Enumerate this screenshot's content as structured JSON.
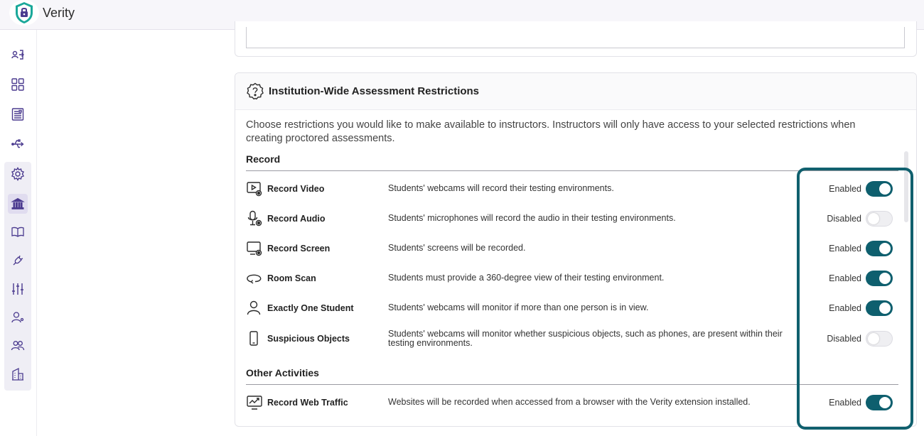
{
  "app": {
    "title": "Verity"
  },
  "card": {
    "title": "Institution-Wide Assessment Restrictions",
    "description": "Choose restrictions you would like to make available to instructors. Instructors will only have access to your selected restrictions when creating proctored assessments."
  },
  "sections": {
    "record": {
      "title": "Record",
      "rows": [
        {
          "name": "Record Video",
          "description": "Students' webcams will record their testing environments.",
          "status": "Enabled",
          "enabled": true,
          "icon": "video-icon"
        },
        {
          "name": "Record Audio",
          "description": "Students' microphones will record the audio in their testing environments.",
          "status": "Disabled",
          "enabled": false,
          "icon": "microphone-icon"
        },
        {
          "name": "Record Screen",
          "description": "Students' screens will be recorded.",
          "status": "Enabled",
          "enabled": true,
          "icon": "screen-icon"
        },
        {
          "name": "Room Scan",
          "description": "Students must provide a 360-degree view of their testing environment.",
          "status": "Enabled",
          "enabled": true,
          "icon": "room-scan-icon"
        },
        {
          "name": "Exactly One Student",
          "description": "Students' webcams will monitor if more than one person is in view.",
          "status": "Enabled",
          "enabled": true,
          "icon": "person-icon"
        },
        {
          "name": "Suspicious Objects",
          "description": "Students' webcams will monitor whether suspicious objects, such as phones, are present within their testing environments.",
          "status": "Disabled",
          "enabled": false,
          "icon": "phone-icon"
        }
      ]
    },
    "other": {
      "title": "Other Activities",
      "rows": [
        {
          "name": "Record Web Traffic",
          "description": "Websites will be recorded when accessed from a browser with the Verity extension installed.",
          "status": "Enabled",
          "enabled": true,
          "icon": "web-traffic-icon"
        }
      ]
    }
  },
  "colors": {
    "accent": "#0e5f6e",
    "highlight": "#10606e",
    "brand_purple": "#4b3b8f",
    "brand_teal": "#1aa89a"
  },
  "rail_icons": [
    "login-icon",
    "dashboard-icon",
    "report-icon",
    "usb-icon",
    "gear-icon",
    "institution-icon",
    "book-icon",
    "plug-icon",
    "sliders-icon",
    "user-settings-icon",
    "users-icon",
    "building-icon"
  ]
}
